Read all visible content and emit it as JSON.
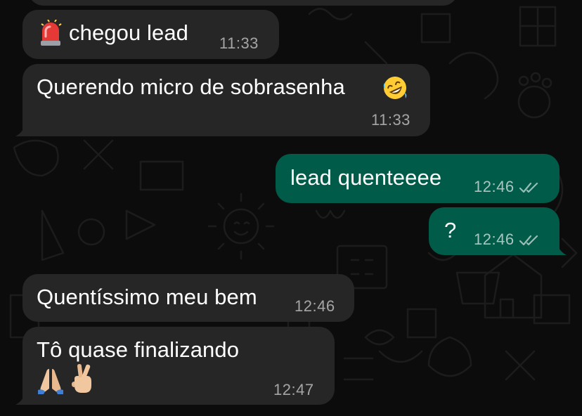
{
  "messages": [
    {
      "id": "m1",
      "direction": "incoming",
      "emoji_before": "police-light-emoji",
      "text": "chegou lead",
      "time": "11:33"
    },
    {
      "id": "m2",
      "direction": "incoming",
      "text": "Querendo micro de sobrasenha",
      "emoji_after": "rolling-on-floor-laughing-emoji",
      "time": "11:33"
    },
    {
      "id": "m3",
      "direction": "outgoing",
      "text": "lead quenteeee",
      "time": "12:46",
      "status": "read-double-check-icon"
    },
    {
      "id": "m4",
      "direction": "outgoing",
      "text": "?",
      "time": "12:46",
      "status": "read-double-check-icon"
    },
    {
      "id": "m5",
      "direction": "incoming",
      "text": "Quentíssimo meu bem",
      "time": "12:46"
    },
    {
      "id": "m6",
      "direction": "incoming",
      "text": "Tô quase finalizando",
      "emojis_line2": [
        "folded-hands-emoji",
        "crossed-fingers-emoji"
      ],
      "time": "12:47"
    }
  ],
  "colors": {
    "incoming_bubble": "#262626",
    "outgoing_bubble": "#005b49",
    "background": "#0c0c0c",
    "meta_text": "#9a9a9a"
  }
}
